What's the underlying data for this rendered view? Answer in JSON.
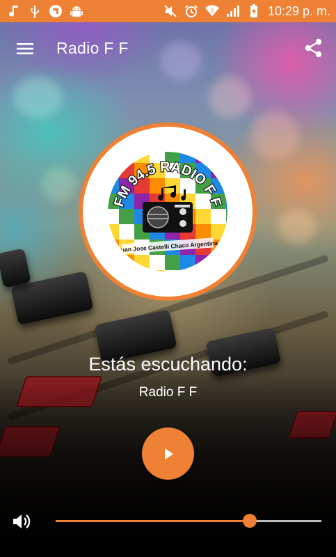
{
  "status_bar": {
    "time": "10:29 p. m.",
    "left_icons": [
      "music-note-icon",
      "usb-icon",
      "app-notification-icon",
      "android-icon"
    ],
    "right_icons": [
      "mute-icon",
      "alarm-icon",
      "wifi-icon",
      "signal-icon",
      "battery-charging-icon"
    ],
    "color": "#ee8133"
  },
  "app_bar": {
    "title": "Radio F F",
    "menu_icon": "hamburger-menu-icon",
    "share_icon": "share-icon"
  },
  "logo": {
    "top_text": "FM 94.5 RADIO F F",
    "bottom_text": "Juan Jose Castelli Chaco Argentina",
    "ring_color": "#ee8133"
  },
  "now_playing": {
    "heading": "Estás escuchando:",
    "station": "Radio F F"
  },
  "player": {
    "play_icon": "play-icon",
    "accent": "#ee8133"
  },
  "volume": {
    "icon": "volume-icon",
    "level_percent": 73
  }
}
